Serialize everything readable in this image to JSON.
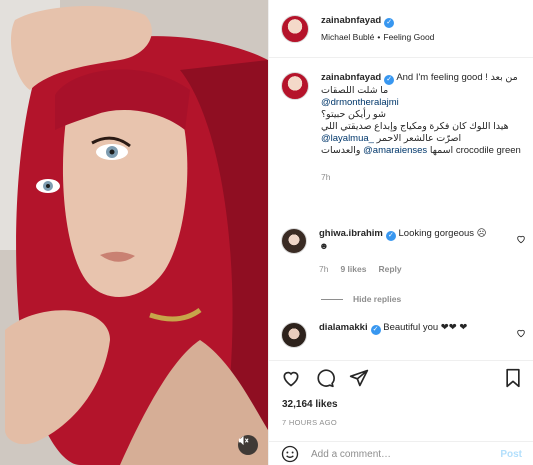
{
  "media": {
    "type": "video",
    "mute_icon": "speaker-muted-icon"
  },
  "header": {
    "username": "zainabnfayad",
    "audio_artist": "Michael Bublé",
    "audio_separator": "•",
    "audio_track": "Feeling Good"
  },
  "caption": {
    "username": "zainabnfayad",
    "line1": "And I'm feeling good !",
    "arabic1": "من بعد ما شلت اللصقات",
    "mention1": "@drmontheralajmi",
    "arabic2": "شو رأيكن حبيتو؟",
    "arabic3": "هيدا اللوك كان فكرة ومكياج وإبداع صديقتي اللي",
    "mention2": "@layalmua_",
    "arabic4": "اصرّت عالشعر الاحمر",
    "arabic5": "والعدسات",
    "mention3": "@amaraienses",
    "arabic6": "اسمها",
    "text_end": "crocodile green",
    "time": "7h"
  },
  "comments": [
    {
      "username": "ghiwa.ibrahim",
      "text": "Looking gorgeous ☹ ☻",
      "time": "7h",
      "likes": "9 likes",
      "reply": "Reply"
    },
    {
      "username": "dialamakki",
      "text": "Beautiful you ❤❤ ❤"
    }
  ],
  "hide_replies": "Hide replies",
  "likes": "32,164 likes",
  "time_ago": "7 HOURS AGO",
  "add_comment": {
    "placeholder": "Add a comment…",
    "post_label": "Post"
  },
  "colors": {
    "link": "#00376b",
    "verified": "#3897f0",
    "muted": "#8e8e8e",
    "post_disabled": "#b2dffc"
  }
}
